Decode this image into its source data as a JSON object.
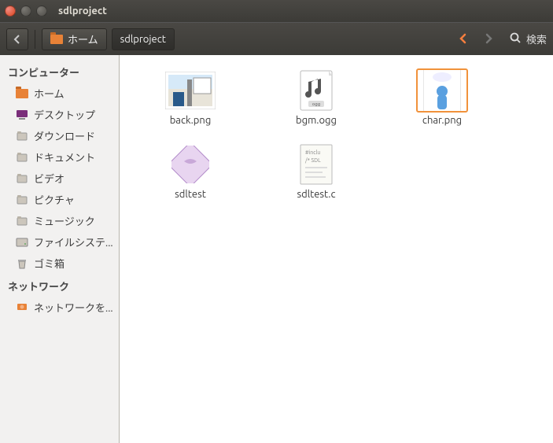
{
  "window": {
    "title": "sdlproject"
  },
  "toolbar": {
    "breadcrumbs": [
      {
        "label": "ホーム",
        "active": false
      },
      {
        "label": "sdlproject",
        "active": true
      }
    ],
    "search_label": "検索"
  },
  "sidebar": {
    "sections": [
      {
        "header": "コンピューター",
        "items": [
          {
            "label": "ホーム",
            "icon": "home"
          },
          {
            "label": "デスクトップ",
            "icon": "desktop"
          },
          {
            "label": "ダウンロード",
            "icon": "folder"
          },
          {
            "label": "ドキュメント",
            "icon": "folder"
          },
          {
            "label": "ビデオ",
            "icon": "folder"
          },
          {
            "label": "ピクチャ",
            "icon": "folder"
          },
          {
            "label": "ミュージック",
            "icon": "folder"
          },
          {
            "label": "ファイルシステ...",
            "icon": "disk"
          },
          {
            "label": "ゴミ箱",
            "icon": "trash"
          }
        ]
      },
      {
        "header": "ネットワーク",
        "items": [
          {
            "label": "ネットワークを...",
            "icon": "network"
          }
        ]
      }
    ]
  },
  "files": [
    {
      "name": "back.png",
      "type": "image-back"
    },
    {
      "name": "bgm.ogg",
      "type": "audio"
    },
    {
      "name": "char.png",
      "type": "image-char",
      "selected": true
    },
    {
      "name": "sdltest",
      "type": "script"
    },
    {
      "name": "sdltest.c",
      "type": "csource"
    }
  ]
}
